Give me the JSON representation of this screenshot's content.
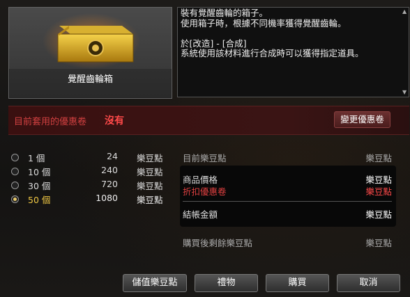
{
  "item": {
    "name": "覺醒齒輪箱",
    "description": "裝有覺醒齒輪的箱子。\n使用箱子時，根據不同機率獲得覺醒齒輪。\n\n於[改造] - [合成]\n系統使用該材料進行合成時可以獲得指定道具。"
  },
  "coupon": {
    "label": "目前套用的優惠卷",
    "value": "沒有",
    "change_button": "變更優惠卷"
  },
  "options": [
    {
      "qty": "1 個",
      "price": "24",
      "unit": "樂豆點",
      "selected": false
    },
    {
      "qty": "10 個",
      "price": "240",
      "unit": "樂豆點",
      "selected": false
    },
    {
      "qty": "30 個",
      "price": "720",
      "unit": "樂豆點",
      "selected": false
    },
    {
      "qty": "50 個",
      "price": "1080",
      "unit": "樂豆點",
      "selected": true
    }
  ],
  "summary": {
    "current_label": "目前樂豆點",
    "current_value": "樂豆點",
    "price_label": "商品價格",
    "price_value": "樂豆點",
    "discount_label": "折扣優惠卷",
    "discount_value": "樂豆點",
    "total_label": "結帳金額",
    "total_value": "樂豆點",
    "remain_label": "購買後剩餘樂豆點",
    "remain_value": "樂豆點"
  },
  "buttons": {
    "charge": "儲值樂豆點",
    "gift": "禮物",
    "buy": "購買",
    "cancel": "取消"
  },
  "colors": {
    "accent_gold": "#f0c844",
    "accent_red": "#ff4a4a"
  }
}
